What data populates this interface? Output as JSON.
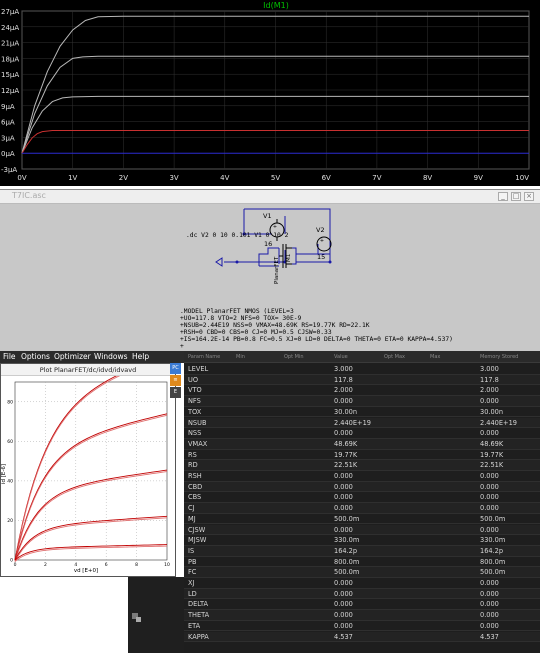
{
  "waveform": {
    "trace_title": "Id(M1)",
    "trace_title_color": "#00c000",
    "y_ticks": [
      "27µA",
      "24µA",
      "21µA",
      "18µA",
      "15µA",
      "12µA",
      "9µA",
      "6µA",
      "3µA",
      "0µA",
      "-3µA"
    ],
    "x_ticks": [
      "0V",
      "1V",
      "2V",
      "3V",
      "4V",
      "5V",
      "6V",
      "7V",
      "8V",
      "9V",
      "10V"
    ]
  },
  "chart_data": {
    "type": "line",
    "title": "Id(M1)",
    "xlabel": "",
    "ylabel": "",
    "xlim": [
      0,
      10
    ],
    "ylim": [
      -3,
      27
    ],
    "grid": true,
    "series": [
      {
        "x": [
          0,
          0.25,
          0.5,
          0.75,
          1.0,
          1.25,
          1.5,
          2,
          3,
          5,
          8,
          10
        ],
        "values": [
          0,
          9.0,
          15.5,
          20.3,
          23.4,
          25.2,
          25.9,
          26.0,
          26.0,
          26.0,
          26.0,
          26.0
        ]
      },
      {
        "x": [
          0,
          0.25,
          0.5,
          0.75,
          1.0,
          1.2,
          1.5,
          2,
          5,
          10
        ],
        "values": [
          0,
          7.5,
          12.8,
          16.3,
          18.0,
          18.3,
          18.4,
          18.4,
          18.4,
          18.4
        ]
      },
      {
        "x": [
          0,
          0.2,
          0.4,
          0.6,
          0.8,
          1.0,
          1.5,
          5,
          10
        ],
        "values": [
          0,
          4.8,
          8.0,
          9.8,
          10.5,
          10.7,
          10.8,
          10.8,
          10.8
        ]
      },
      {
        "x": [
          0,
          0.1,
          0.2,
          0.3,
          0.4,
          0.6,
          1,
          5,
          10
        ],
        "values": [
          0,
          1.6,
          2.9,
          3.7,
          4.1,
          4.3,
          4.3,
          4.3,
          4.3
        ]
      },
      {
        "x": [
          0,
          10
        ],
        "values": [
          0,
          0
        ]
      }
    ],
    "colors": [
      "#b8b8b8",
      "#b8b8b8",
      "#b8b8b8",
      "#c83030",
      "#2a2ad0"
    ]
  },
  "schematic": {
    "window_title": "T7IC.asc",
    "dc_directive": ".dc V2 0 10 0.101 V1 0 10 2",
    "v1_label": "V1",
    "v1_value": "16",
    "v2_label": "V2",
    "v2_value": "15",
    "m1_label": "M1",
    "model_label": "PlanarFET",
    "model_lines": [
      ".MODEL PlanarFET NMOS (LEVEL=3",
      "+UO=117.8 VTO=2 NFS=0 TOX= 30E-9",
      "+NSUB=2.44E19 NSS=0 VMAX=48.69K RS=19.77K RD=22.1K",
      "+RSH=0 CBD=0 CBS=0 CJ=0 MJ=0.5 CJSW=0.33",
      "+IS=164.2E-14 PB=0.8 FC=0.5 XJ=0 LD=0 DELTA=0 THETA=0 ETA=0 KAPPA=4.537)",
      "+"
    ]
  },
  "menu": [
    "File",
    "Options",
    "Optimizer",
    "Windows",
    "Help"
  ],
  "side_toolbar": [
    {
      "label": "PC",
      "color": "#3b7bd4"
    },
    {
      "label": "≡",
      "color": "#e08a1c"
    },
    {
      "label": "E",
      "color": "#444444"
    }
  ],
  "plot": {
    "title": "Plot PlanarFET/dc/idvd/idvavd",
    "xlabel": "vd [E+0]",
    "ylabel": "id [E-6]",
    "x_ticks": [
      "0",
      "2",
      "4",
      "6",
      "8",
      "10"
    ],
    "y_ticks": [
      "0",
      "20",
      "40",
      "60",
      "80"
    ]
  },
  "table": {
    "headers": [
      "Param Name",
      "Min",
      "Opt Min",
      "Value",
      "Opt Max",
      "Max",
      "Memory Stored"
    ],
    "rows": [
      [
        "LEVEL",
        "3.000",
        "3.000"
      ],
      [
        "UO",
        "117.8",
        "117.8"
      ],
      [
        "VTO",
        "2.000",
        "2.000"
      ],
      [
        "NFS",
        "0.000",
        "0.000"
      ],
      [
        "TOX",
        "30.00n",
        "30.00n"
      ],
      [
        "NSUB",
        "2.440E+19",
        "2.440E+19"
      ],
      [
        "NSS",
        "0.000",
        "0.000"
      ],
      [
        "VMAX",
        "48.69K",
        "48.69K"
      ],
      [
        "RS",
        "19.77K",
        "19.77K"
      ],
      [
        "RD",
        "22.51K",
        "22.51K"
      ],
      [
        "RSH",
        "0.000",
        "0.000"
      ],
      [
        "CBD",
        "0.000",
        "0.000"
      ],
      [
        "CBS",
        "0.000",
        "0.000"
      ],
      [
        "CJ",
        "0.000",
        "0.000"
      ],
      [
        "MJ",
        "500.0m",
        "500.0m"
      ],
      [
        "CJSW",
        "0.000",
        "0.000"
      ],
      [
        "MJSW",
        "330.0m",
        "330.0m"
      ],
      [
        "IS",
        "164.2p",
        "164.2p"
      ],
      [
        "PB",
        "800.0m",
        "800.0m"
      ],
      [
        "FC",
        "500.0m",
        "500.0m"
      ],
      [
        "XJ",
        "0.000",
        "0.000"
      ],
      [
        "LD",
        "0.000",
        "0.000"
      ],
      [
        "DELTA",
        "0.000",
        "0.000"
      ],
      [
        "THETA",
        "0.000",
        "0.000"
      ],
      [
        "ETA",
        "0.000",
        "0.000"
      ],
      [
        "KAPPA",
        "4.537",
        "4.537"
      ]
    ]
  }
}
